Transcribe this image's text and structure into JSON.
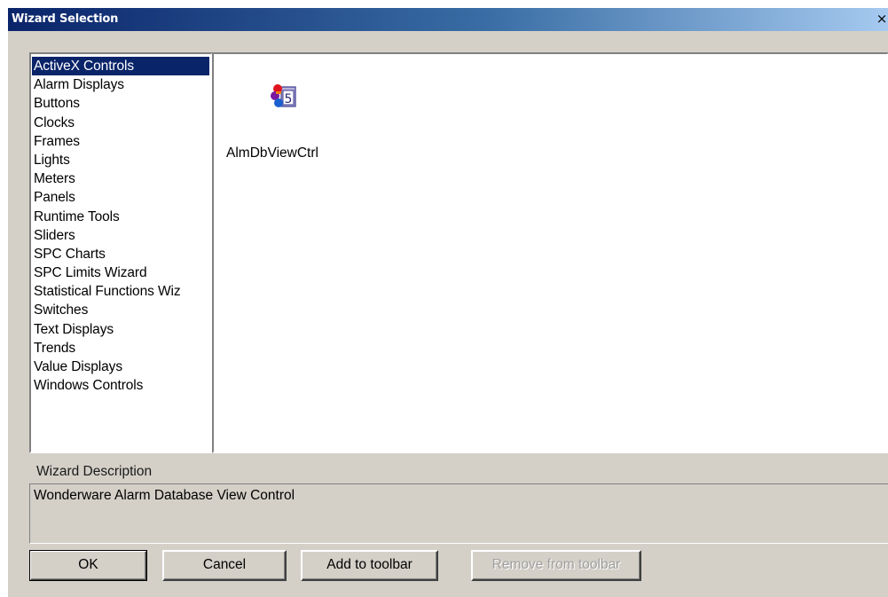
{
  "window": {
    "title": "Wizard Selection",
    "close_glyph": "×"
  },
  "categories": [
    {
      "label": "ActiveX Controls",
      "selected": true
    },
    {
      "label": "Alarm Displays",
      "selected": false
    },
    {
      "label": "Buttons",
      "selected": false
    },
    {
      "label": "Clocks",
      "selected": false
    },
    {
      "label": "Frames",
      "selected": false
    },
    {
      "label": "Lights",
      "selected": false
    },
    {
      "label": "Meters",
      "selected": false
    },
    {
      "label": "Panels",
      "selected": false
    },
    {
      "label": "Runtime Tools",
      "selected": false
    },
    {
      "label": "Sliders",
      "selected": false
    },
    {
      "label": "SPC Charts",
      "selected": false
    },
    {
      "label": "SPC Limits Wizard",
      "selected": false
    },
    {
      "label": "Statistical Functions Wiz",
      "selected": false
    },
    {
      "label": "Switches",
      "selected": false
    },
    {
      "label": "Text Displays",
      "selected": false
    },
    {
      "label": "Trends",
      "selected": false
    },
    {
      "label": "Value Displays",
      "selected": false
    },
    {
      "label": "Windows Controls",
      "selected": false
    }
  ],
  "wizards": [
    {
      "label": "AlmDbViewCtrl",
      "icon": "almdbviewctrl-icon"
    }
  ],
  "description": {
    "label": "Wizard Description",
    "text": "Wonderware Alarm Database View Control"
  },
  "buttons": {
    "ok": "OK",
    "cancel": "Cancel",
    "add_toolbar": "Add to toolbar",
    "remove_toolbar": "Remove from toolbar"
  },
  "colors": {
    "selection": "#0a246a",
    "face": "#d4d0c8"
  }
}
